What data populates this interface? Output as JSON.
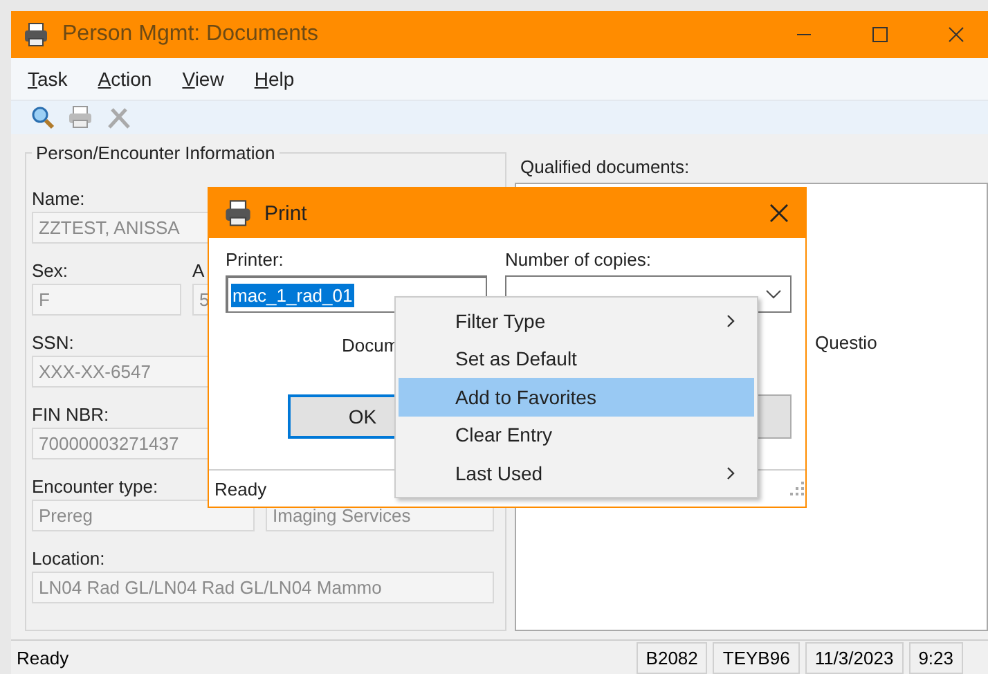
{
  "window": {
    "title": "Person Mgmt: Documents"
  },
  "menu": [
    {
      "label": "Task"
    },
    {
      "label": "Action"
    },
    {
      "label": "View"
    },
    {
      "label": "Help"
    }
  ],
  "person_info": {
    "title": "Person/Encounter Information",
    "rows": [
      {
        "cells": [
          {
            "label": "Name:",
            "value": "ZZTEST, ANISSA"
          }
        ]
      },
      {
        "cells": [
          {
            "label": "Sex:",
            "value": "F"
          },
          {
            "label": "A",
            "value": "5"
          }
        ]
      },
      {
        "cells": [
          {
            "label": "SSN:",
            "value": "XXX-XX-6547"
          }
        ]
      },
      {
        "cells": [
          {
            "label": "FIN NBR:",
            "value": "70000003271437"
          }
        ]
      },
      {
        "cells": [
          {
            "label": "Encounter type:",
            "value": "Prereg"
          },
          {
            "value": "Imaging Services"
          }
        ]
      },
      {
        "cells": [
          {
            "label": "Location:",
            "value": "LN04 Rad GL/LN04 Rad GL/LN04 Mammo"
          }
        ]
      }
    ]
  },
  "documents": {
    "label": "Qualified documents:",
    "text": "Questio"
  },
  "status_bar": {
    "message": "Ready",
    "panels": [
      "B2082",
      "TEYB96",
      "11/3/2023",
      "9:23"
    ]
  },
  "print_dialog": {
    "title": "Print",
    "printer_label": "Printer:",
    "printer_value": "mac_1_rad_01",
    "copies_label": "Number of copies:",
    "document_text": "Docum",
    "ok": "OK",
    "status": "Ready"
  },
  "context_menu": {
    "items": [
      {
        "label": "Filter Type",
        "submenu": true,
        "selected": false
      },
      {
        "label": "Set as Default",
        "submenu": false,
        "selected": false
      },
      {
        "label": "Add to Favorites",
        "submenu": false,
        "selected": true
      },
      {
        "label": "Clear Entry",
        "submenu": false,
        "selected": false
      },
      {
        "label": "Last Used",
        "submenu": true,
        "selected": false
      }
    ]
  }
}
